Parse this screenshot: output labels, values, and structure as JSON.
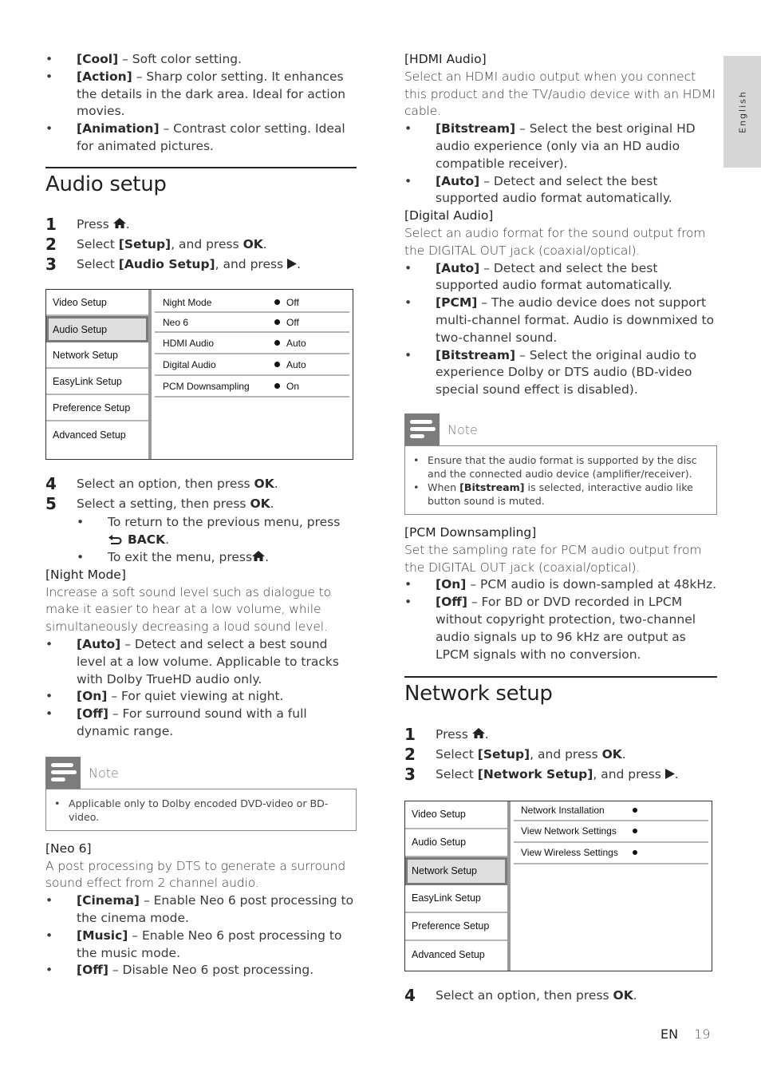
{
  "side_tab": {
    "language": "English"
  },
  "footer": {
    "lang": "EN",
    "page_number": "19"
  },
  "left": {
    "intro_bullets": [
      {
        "term": "[Cool]",
        "text": " – Soft color setting."
      },
      {
        "term": "[Action]",
        "text": " – Sharp color setting. It enhances the details in the dark area. Ideal for action movies."
      },
      {
        "term": "[Animation]",
        "text": " – Contrast color setting. Ideal for animated pictures."
      }
    ],
    "audio_setup": {
      "title": "Audio setup",
      "steps": [
        {
          "num": "1",
          "pre": "Press ",
          "icon": "home-icon",
          "bold": "",
          "post": "."
        },
        {
          "num": "2",
          "pre": "Select ",
          "bold": "[Setup]",
          "mid": ", and press ",
          "bold2": "OK",
          "post": "."
        },
        {
          "num": "3",
          "pre": "Select ",
          "bold": "[Audio Setup]",
          "mid": ", and press ",
          "icon": "play-right-icon",
          "post": "."
        }
      ],
      "menu": {
        "categories": [
          "Video Setup",
          "Audio Setup",
          "Network Setup",
          "EasyLink Setup",
          "Preference Setup",
          "Advanced Setup"
        ],
        "selected_category": "Audio Setup",
        "options": [
          {
            "name": "Night Mode",
            "value": "Off"
          },
          {
            "name": "Neo 6",
            "value": "Off"
          },
          {
            "name": "HDMI Audio",
            "value": "Auto"
          },
          {
            "name": "Digital Audio",
            "value": "Auto"
          },
          {
            "name": "PCM Downsampling",
            "value": "On"
          }
        ]
      },
      "steps_after": [
        {
          "num": "4",
          "pre": "Select an option, then press ",
          "bold": "OK",
          "post": "."
        },
        {
          "num": "5",
          "pre": "Select a setting, then press ",
          "bold": "OK",
          "post": "."
        }
      ],
      "sub_bullets": [
        {
          "pre": "To return to the previous menu, press",
          "icon": "back-icon",
          "bold": "BACK",
          "post": "."
        },
        {
          "pre": "To exit the menu, press",
          "icon": "home-icon",
          "post": "."
        }
      ]
    },
    "night_mode": {
      "heading": "[Night Mode]",
      "desc": "Increase a soft sound level such as dialogue to make it easier to hear at a low volume, while simultaneously decreasing a loud sound level.",
      "bullets": [
        {
          "term": "[Auto]",
          "text": " – Detect and select a best sound level at a low volume. Applicable to tracks with Dolby TrueHD audio only."
        },
        {
          "term": "[On]",
          "text": " – For quiet viewing at night."
        },
        {
          "term": "[Off]",
          "text": " – For surround sound with a full dynamic range."
        }
      ],
      "note": {
        "label": "Note",
        "items": [
          "Applicable only to Dolby encoded DVD-video or BD-video."
        ]
      }
    },
    "neo6": {
      "heading": "[Neo 6]",
      "desc": "A post processing by DTS to generate a surround sound effect from 2 channel audio.",
      "bullets": [
        {
          "term": "[Cinema]",
          "text": " – Enable Neo 6 post processing to the cinema mode."
        },
        {
          "term": "[Music]",
          "text": " – Enable Neo 6 post processing to the music mode."
        },
        {
          "term": "[Off]",
          "text": " – Disable Neo 6 post processing."
        }
      ]
    }
  },
  "right": {
    "hdmi_audio": {
      "heading": "[HDMI Audio]",
      "desc": "Select an HDMI audio output when you connect this product and the TV/audio device with an HDMI cable.",
      "bullets": [
        {
          "term": "[Bitstream]",
          "text": " – Select the best original HD audio experience (only via an HD audio compatible receiver)."
        },
        {
          "term": "[Auto]",
          "text": " – Detect and select the best supported audio format automatically."
        }
      ]
    },
    "digital_audio": {
      "heading": "[Digital Audio]",
      "desc": "Select an audio format for the sound output from the DIGITAL OUT jack (coaxial/optical).",
      "bullets": [
        {
          "term": "[Auto]",
          "text": " – Detect and select the best supported audio format automatically."
        },
        {
          "term": "[PCM]",
          "text": " – The audio device does not support multi-channel format. Audio is downmixed to two-channel sound."
        },
        {
          "term": "[Bitstream]",
          "text": " – Select the original audio to experience Dolby or DTS audio (BD-video special sound effect is disabled)."
        }
      ],
      "note": {
        "label": "Note",
        "item1": "Ensure that the audio format is supported by the disc and the connected audio device (amplifier/receiver).",
        "item2_pre": "When ",
        "item2_bold": "[Bitstream]",
        "item2_post": " is selected, interactive audio like button sound is muted."
      }
    },
    "pcm_downsampling": {
      "heading": "[PCM Downsampling]",
      "desc": "Set the sampling rate for PCM audio output from the DIGITAL OUT jack (coaxial/optical).",
      "bullets": [
        {
          "term": "[On]",
          "text": " – PCM audio is down-sampled at 48kHz."
        },
        {
          "term": "[Off]",
          "text": " – For BD or DVD recorded in LPCM without copyright protection, two-channel audio signals up to 96 kHz are output as LPCM signals with no conversion."
        }
      ]
    },
    "network_setup": {
      "title": "Network setup",
      "steps": [
        {
          "num": "1",
          "pre": "Press ",
          "post": "."
        },
        {
          "num": "2",
          "pre": "Select ",
          "bold": "[Setup]",
          "mid": ", and press ",
          "bold2": "OK",
          "post": "."
        },
        {
          "num": "3",
          "pre": "Select ",
          "bold": "[Network Setup]",
          "mid": ", and press ",
          "post": "."
        }
      ],
      "menu": {
        "categories": [
          "Video Setup",
          "Audio Setup",
          "Network Setup",
          "EasyLink Setup",
          "Preference Setup",
          "Advanced Setup"
        ],
        "selected_category": "Network Setup",
        "options": [
          {
            "name": "Network Installation"
          },
          {
            "name": "View Network Settings"
          },
          {
            "name": "View Wireless Settings"
          }
        ]
      },
      "steps_after": [
        {
          "num": "4",
          "pre": "Select an option, then press ",
          "bold": "OK",
          "post": "."
        }
      ]
    }
  }
}
